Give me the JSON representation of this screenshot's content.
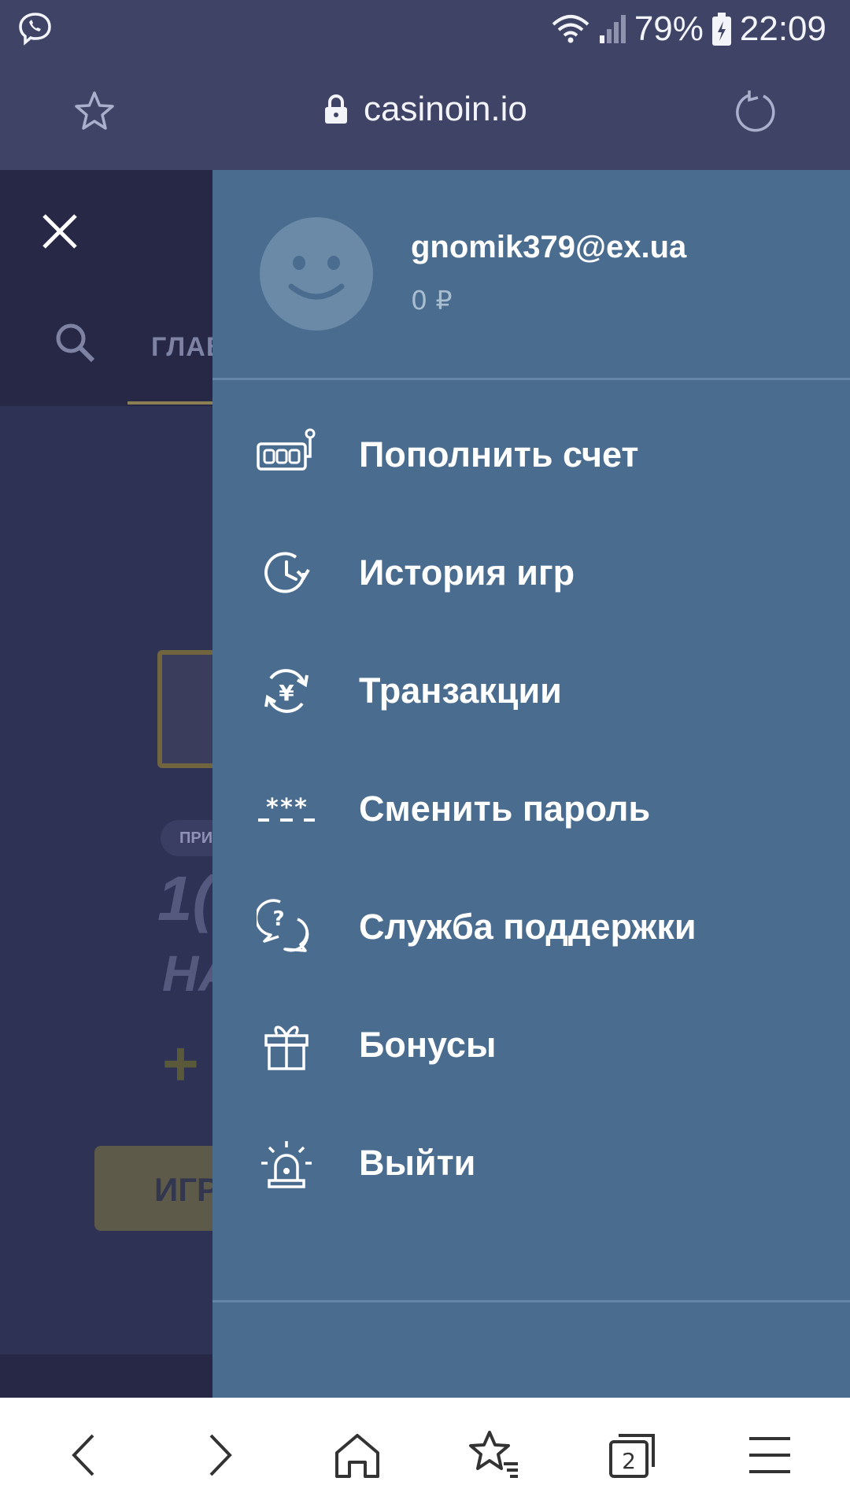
{
  "status_bar": {
    "battery_percent": "79%",
    "time": "22:09"
  },
  "browser": {
    "url": "casinoin.io"
  },
  "background_page": {
    "tab_fragment": "ГЛАВ",
    "pill_fragment": "ПРИ",
    "headline_fragment_1": "1(",
    "headline_fragment_2": "НА",
    "plus_fragment": "+",
    "button_fragment": "ИГР"
  },
  "profile": {
    "email": "gnomik379@ex.ua",
    "balance": "0 ₽"
  },
  "menu": {
    "items": [
      {
        "label": "Пополнить счет",
        "icon": "slot-machine-icon"
      },
      {
        "label": "История игр",
        "icon": "history-clock-icon"
      },
      {
        "label": "Транзакции",
        "icon": "currency-exchange-icon"
      },
      {
        "label": "Сменить пароль",
        "icon": "password-icon"
      },
      {
        "label": "Служба поддержки",
        "icon": "support-chat-icon"
      },
      {
        "label": "Бонусы",
        "icon": "gift-icon"
      },
      {
        "label": "Выйти",
        "icon": "alarm-light-icon"
      }
    ]
  },
  "bottom_nav": {
    "tabs_count": "2"
  },
  "colors": {
    "drawer_bg": "#4a6c8f",
    "browser_bar": "#3f4466",
    "page_bg": "#2e3356"
  }
}
